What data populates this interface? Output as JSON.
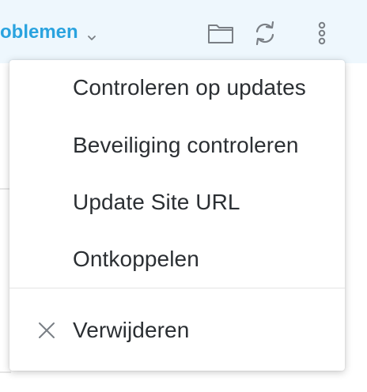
{
  "header": {
    "title": "oblemen",
    "icons": {
      "dropdown": "chevron-down-icon",
      "folder": "folder-icon",
      "refresh": "refresh-icon",
      "more": "more-vertical-icon"
    }
  },
  "menu": {
    "items": [
      {
        "label": "Controleren op updates"
      },
      {
        "label": "Beveiliging controleren"
      },
      {
        "label": "Update Site URL"
      },
      {
        "label": "Ontkoppelen"
      }
    ],
    "remove": {
      "label": "Verwijderen",
      "icon": "close-icon"
    }
  },
  "colors": {
    "header_background": "#eef7fd",
    "accent": "#2aa3df",
    "text": "#2b2f33",
    "icon": "#7a7f85"
  }
}
